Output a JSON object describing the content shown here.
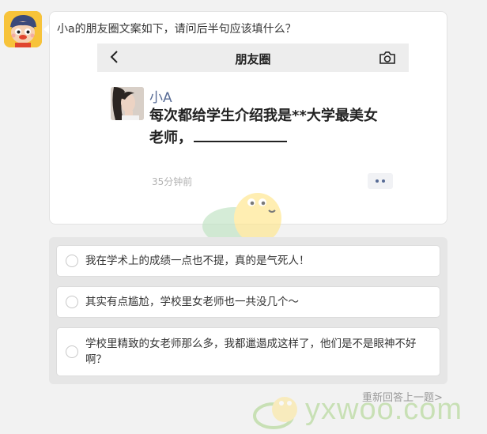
{
  "question": "小a的朋友圈文案如下，请问后半句应该填什么？",
  "moments": {
    "title": "朋友圈",
    "post": {
      "author": "小A",
      "text_line1": "每次都给学生介绍我是**大学最美女",
      "text_line2": "老师，",
      "time": "35分钟前"
    }
  },
  "options": [
    {
      "text": "我在学术上的成绩一点也不提，真的是气死人！"
    },
    {
      "text": "其实有点尴尬，学校里女老师也一共没几个～"
    },
    {
      "text": "学校里精致的女老师那么多，我都邋遢成这样了，他们是不是眼神不好啊？"
    }
  ],
  "retry_label": "重新回答上一题>",
  "watermark": {
    "site": "yxwoo.com"
  },
  "colors": {
    "page_bg": "#f2f2f2",
    "wechat_link": "#576b95",
    "watermark": "#9fd07a"
  }
}
